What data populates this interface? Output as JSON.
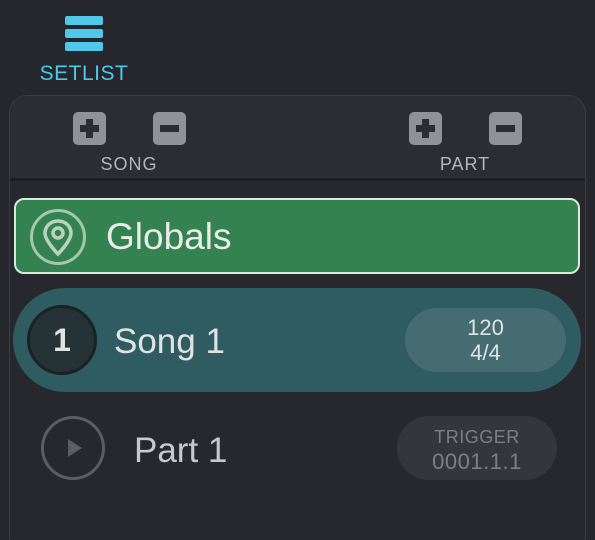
{
  "header": {
    "setlist_label": "SETLIST",
    "icon": "hamburger-menu-icon"
  },
  "toolbar": {
    "song_label": "SONG",
    "part_label": "PART",
    "add_icon": "plus-icon",
    "remove_icon": "minus-icon"
  },
  "globals": {
    "label": "Globals",
    "icon": "location-pin-icon"
  },
  "songs": [
    {
      "number": "1",
      "label": "Song 1",
      "tempo": "120",
      "signature": "4/4"
    }
  ],
  "parts": [
    {
      "label": "Part 1",
      "trigger_label": "TRIGGER",
      "trigger_value": "0001.1.1",
      "icon": "play-icon"
    }
  ],
  "colors": {
    "accent": "#4fc8ea",
    "globals_bg": "#348250",
    "song_bg": "#2f5c61",
    "background": "#25272c"
  }
}
